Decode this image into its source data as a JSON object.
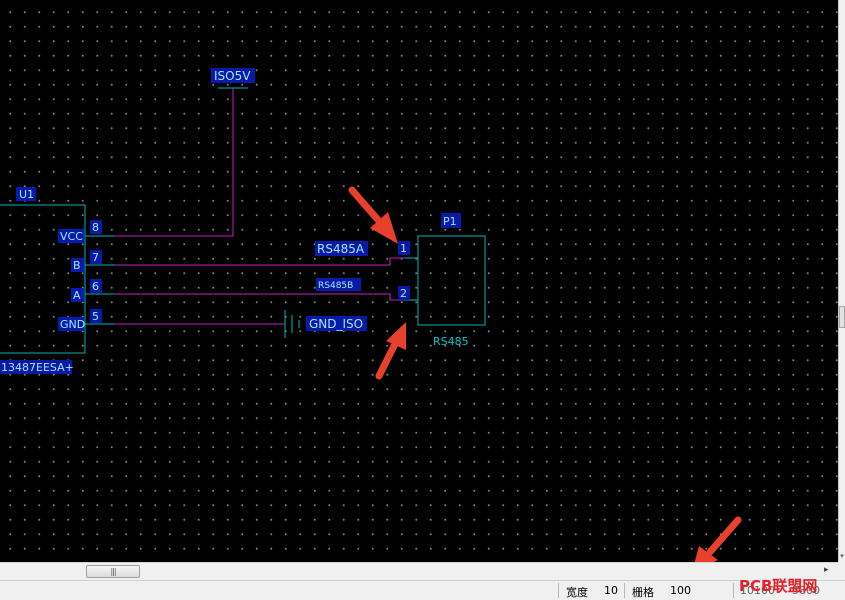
{
  "schematic": {
    "u1": {
      "designator": "U1",
      "part_label": "13487EESA+",
      "pins": [
        {
          "name": "VCC",
          "number": "8"
        },
        {
          "name": "B",
          "number": "7"
        },
        {
          "name": "A",
          "number": "6"
        },
        {
          "name": "GND",
          "number": "5"
        }
      ]
    },
    "p1": {
      "designator": "P1",
      "comment": "RS485",
      "pins": [
        {
          "number": "1"
        },
        {
          "number": "2"
        }
      ]
    },
    "net_labels": {
      "power": "ISO5V",
      "rs485a": "RS485A",
      "rs485b": "RS485B",
      "ground": "GND_ISO"
    },
    "colors": {
      "wire": "#c61ac6",
      "component_outline": "#00b4b4",
      "text_pin": "#4cd0ff",
      "label_bg": "#0a1aa8",
      "label_text": "#9fe6ff",
      "arrow": "#e8412b"
    }
  },
  "status_bar": {
    "width_label": "宽度",
    "width_value": "10",
    "grid_label": "栅格",
    "grid_value": "100",
    "coord_x": "10100",
    "coord_y": "5800"
  },
  "watermark": "PCB联盟网"
}
